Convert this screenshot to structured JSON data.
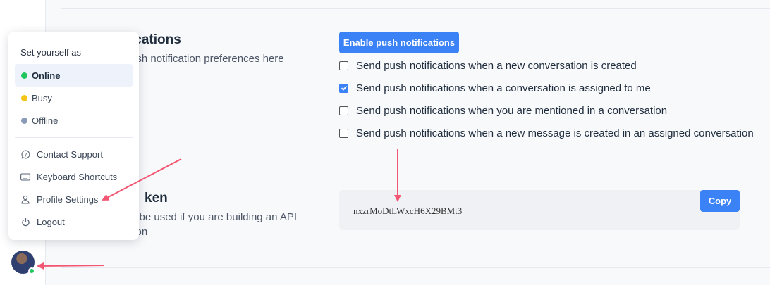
{
  "colors": {
    "primary": "#3b82f6",
    "online": "#22c55e",
    "busy": "#f5c518",
    "offline": "#8a9bb8",
    "annotation_arrow": "#f25672"
  },
  "push": {
    "title": "ications",
    "description": "ush notification preferences here",
    "enable_button": "Enable push notifications",
    "options": [
      {
        "label": "Send push notifications when a new conversation is created",
        "checked": false
      },
      {
        "label": "Send push notifications when a conversation is assigned to me",
        "checked": true
      },
      {
        "label": "Send push notifications when you are mentioned in a conversation",
        "checked": false
      },
      {
        "label": "Send push notifications when a new message is created in an assigned conversation",
        "checked": false
      }
    ]
  },
  "token": {
    "title": "ken",
    "description_line1": "n be used if you are building an API",
    "description_line2": "tion",
    "value": "nxzrMoDtLWxcH6X29BMt3",
    "copy_button": "Copy"
  },
  "menu": {
    "header": "Set yourself as",
    "statuses": [
      {
        "label": "Online",
        "color": "#22c55e",
        "active": true
      },
      {
        "label": "Busy",
        "color": "#f5c518",
        "active": false
      },
      {
        "label": "Offline",
        "color": "#8a9bb8",
        "active": false
      }
    ],
    "items": [
      {
        "label": "Contact Support",
        "icon": "chat-help-icon"
      },
      {
        "label": "Keyboard Shortcuts",
        "icon": "keyboard-icon"
      },
      {
        "label": "Profile Settings",
        "icon": "person-icon"
      },
      {
        "label": "Logout",
        "icon": "power-icon"
      }
    ]
  },
  "avatar": {
    "status": "online"
  }
}
